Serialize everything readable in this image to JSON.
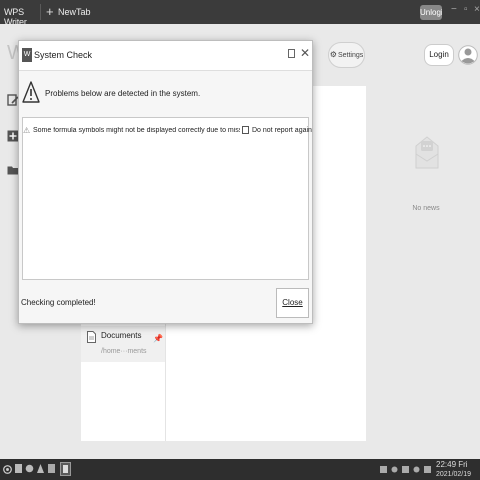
{
  "titlebar": {
    "app_tab": "WPS Writer",
    "new_tab_icon": "plus-icon",
    "new_tab_label": "NewTab",
    "unlogin_label": "Unlogin",
    "window_controls": [
      "minimize-icon",
      "restore-icon",
      "close-icon"
    ]
  },
  "workspace": {
    "logo_letter": "W",
    "settings_label": "Settings",
    "login_label": "Login",
    "recent_doc": {
      "name": "Documents",
      "path": "/home···ments"
    },
    "news": {
      "empty_text": "No news"
    }
  },
  "dialog": {
    "title": "System Check",
    "logo_letter": "W",
    "problem_text": "Problems below are detected in the system.",
    "items": [
      {
        "text": "Some formula symbols might not be displayed correctly due to missi···",
        "checkbox_label": "Do not report again",
        "checked": false
      }
    ],
    "status_text": "Checking completed!",
    "close_label": "Close"
  },
  "taskbar": {
    "time": "22:49 Fri",
    "date": "2021/02/19"
  },
  "colors": {
    "titlebar": "#3b3b3b",
    "workspace": "#e9e9e9",
    "taskbar": "#2e2e2e",
    "dialog": "#f6f6f6"
  }
}
